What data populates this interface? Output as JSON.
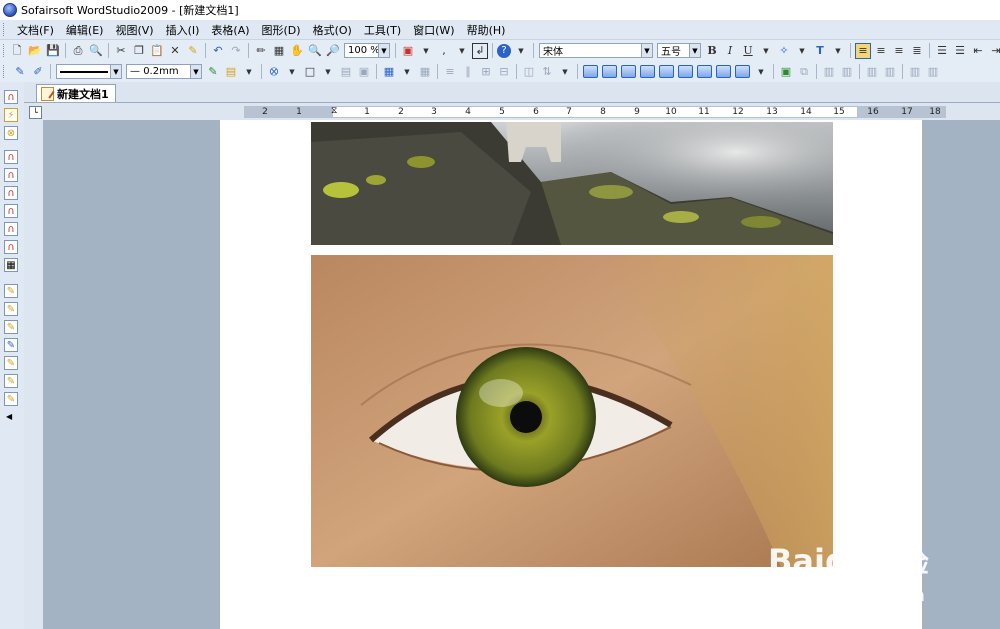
{
  "window": {
    "title": "Sofairsoft WordStudio2009 - [新建文档1]"
  },
  "menu": [
    "文档(F)",
    "编辑(E)",
    "视图(V)",
    "插入(I)",
    "表格(A)",
    "图形(D)",
    "格式(O)",
    "工具(T)",
    "窗口(W)",
    "帮助(H)"
  ],
  "toolbar": {
    "zoom": "100 %",
    "font_name": "宋体",
    "font_size": "五号",
    "bold": "B",
    "italic": "I",
    "underline": "U",
    "line_width": "0.2mm"
  },
  "tabs": [
    {
      "label": "新建文档1",
      "active": true
    }
  ],
  "ruler": {
    "ticks": [
      "2",
      "1",
      "1",
      "2",
      "3",
      "4",
      "5",
      "6",
      "7",
      "8",
      "9",
      "10",
      "11",
      "12",
      "13",
      "14",
      "15",
      "16",
      "17",
      "18"
    ]
  },
  "document": {
    "images": [
      {
        "name": "rock-landscape-image",
        "description": "mossy rocks with clouds"
      },
      {
        "name": "eye-closeup-image",
        "description": "close-up of a green eye"
      }
    ]
  },
  "watermark": {
    "brand": "Baidu",
    "brand_cn": "经验",
    "url": "jingyan.baidu.com"
  },
  "colors": {
    "menubar": "#dfe8f3",
    "workspace": "#a4b3c3",
    "accent": "#2a62c8"
  }
}
